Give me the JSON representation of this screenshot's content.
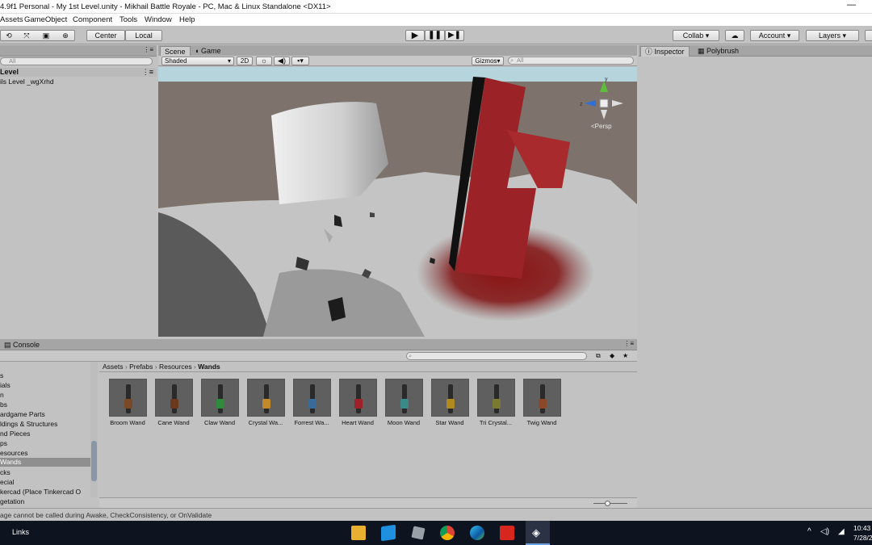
{
  "window": {
    "title": "4.9f1 Personal - My 1st Level.unity - Mikhail Battle Royale - PC, Mac & Linux Standalone <DX11>",
    "minimize_glyph": "—"
  },
  "menu": [
    "Assets",
    "GameObject",
    "Component",
    "Tools",
    "Window",
    "Help"
  ],
  "toolbar": {
    "center": "Center",
    "local": "Local",
    "collab": "Collab",
    "account": "Account",
    "layers": "Layers",
    "play_icon": "play-icon",
    "pause_icon": "pause-icon",
    "step_icon": "step-icon"
  },
  "hierarchy": {
    "search_placeholder": "All",
    "scene_name": "Level",
    "items": [
      "ils Level _wgXrhd"
    ]
  },
  "scene": {
    "tabs": [
      "Scene",
      "Game"
    ],
    "shading": "Shaded",
    "mode_2d": "2D",
    "gizmos": "Gizmos",
    "search_placeholder": "All",
    "persp": "<Persp"
  },
  "inspector": {
    "tabs": [
      "Inspector",
      "Polybrush"
    ]
  },
  "project": {
    "console_tab": "Console",
    "breadcrumb": [
      "Assets",
      "Prefabs",
      "Resources",
      "Wands"
    ],
    "folders": [
      "s",
      "ials",
      "n",
      "bs",
      "ardgame Parts",
      "ldings & Structures",
      "nd Pieces",
      "ps",
      "esources",
      "Wands",
      "cks",
      "ecial",
      "kercad (Place Tinkercad O",
      "getation"
    ],
    "selected_folder_index": 9,
    "assets": [
      {
        "name": "Broom Wand",
        "color": "#7a4a28"
      },
      {
        "name": "Cane Wand",
        "color": "#6b3a1e"
      },
      {
        "name": "Claw Wand",
        "color": "#2f8a3b"
      },
      {
        "name": "Crystal Wa...",
        "color": "#c08a2a"
      },
      {
        "name": "Forrest Wa...",
        "color": "#3a6a9a"
      },
      {
        "name": "Heart Wand",
        "color": "#a0202a"
      },
      {
        "name": "Moon Wand",
        "color": "#3a8a8a"
      },
      {
        "name": "Star Wand",
        "color": "#b08a20"
      },
      {
        "name": "Tri Crystal...",
        "color": "#7a7a30"
      },
      {
        "name": "Twig Wand",
        "color": "#8a4a2a"
      }
    ],
    "zoom": 0.4
  },
  "status": {
    "message": "age cannot be called during Awake, CheckConsistency, or OnValidate"
  },
  "taskbar": {
    "links": "Links",
    "time": "10:43",
    "date": "7/28/2"
  }
}
